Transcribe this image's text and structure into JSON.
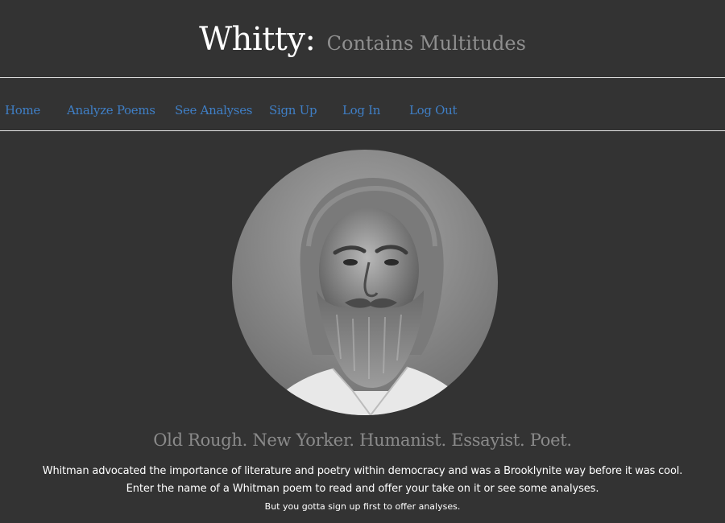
{
  "header": {
    "brand": "Whitty:",
    "tagline": "Contains Multitudes"
  },
  "nav": {
    "items": [
      {
        "label": "Home"
      },
      {
        "label": "Analyze Poems"
      },
      {
        "label": "See Analyses"
      },
      {
        "label": "Sign Up"
      },
      {
        "label": "Log In"
      },
      {
        "label": "Log Out"
      }
    ]
  },
  "hero": {
    "subtitle": "Old Rough. New Yorker. Humanist. Essayist. Poet.",
    "line1": "Whitman advocated the importance of literature and poetry within democracy and was a Brooklynite way before it was cool.",
    "line2": "Enter the name of a Whitman poem to read and offer your take on it or see some analyses.",
    "line3": "But you gotta sign up first to offer analyses."
  },
  "colors": {
    "background": "#333333",
    "link": "#3f7fc6",
    "muted_text": "#8a8a8a"
  }
}
